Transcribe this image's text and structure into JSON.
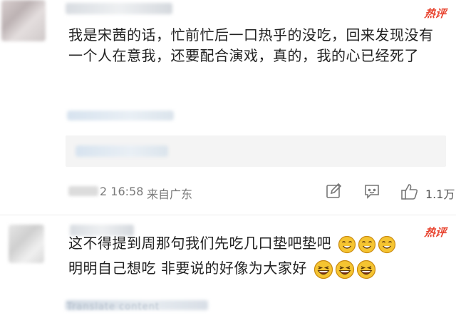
{
  "comments": [
    {
      "hot_label": "热评",
      "text": "我是宋茜的话，忙前忙后一口热乎的没吃，回来发现没有一个人在意我，还要配合演戏，真的，我的心已经死了",
      "time": "2 16:58",
      "source": "来自广东",
      "like_count": "1.1万"
    },
    {
      "hot_label": "热评",
      "line1": "这不得提到周那句我们先吃几口垫吧垫吧",
      "line2": "明明自己想吃 非要说的好像为大家好",
      "blurred_footer": "Translate content"
    }
  ],
  "icons": {
    "edit": "edit-icon",
    "comment": "comment-icon",
    "like": "thumbs-up-icon",
    "emoji1": "eyes-closed-smile-emoji",
    "emoji2": "laughing-emoji"
  },
  "colors": {
    "hot": "#e8412c",
    "meta": "#7a7a7a",
    "emoji_face": "#f5c431",
    "emoji_outline": "#c98a10"
  }
}
